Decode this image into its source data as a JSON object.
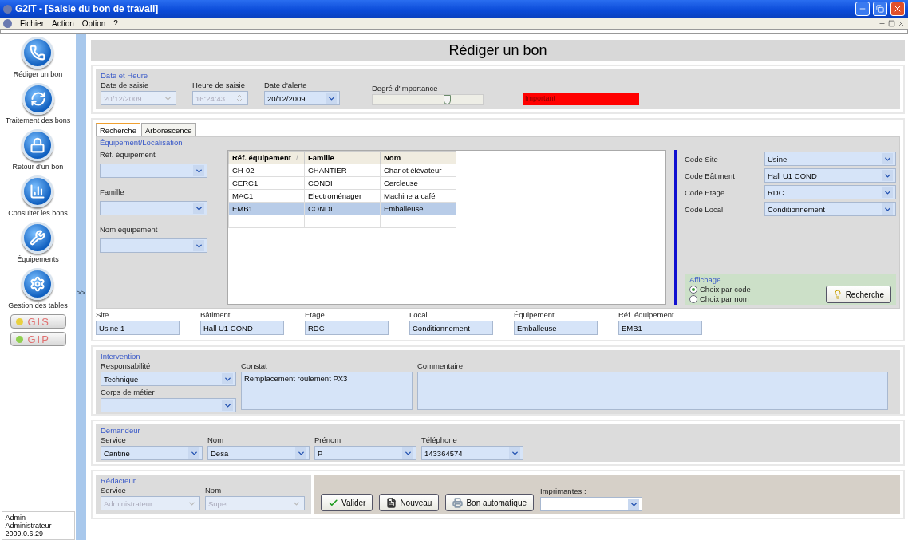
{
  "window": {
    "title": "G2IT - [Saisie du bon de travail]"
  },
  "menu": [
    "Fichier",
    "Action",
    "Option",
    "?"
  ],
  "sidebar": {
    "items": [
      {
        "label": "Rédiger un bon",
        "kind": "phone"
      },
      {
        "label": "Traitement des bons",
        "kind": "refresh"
      },
      {
        "label": "Retour d'un bon",
        "kind": "lock"
      },
      {
        "label": "Consulter les bons",
        "kind": "chart"
      },
      {
        "label": "Équipements",
        "kind": "tools"
      },
      {
        "label": "Gestion des tables",
        "kind": "gear"
      }
    ],
    "badges": [
      {
        "label": "GIS",
        "color": "#e8d040"
      },
      {
        "label": "GIP",
        "color": "#90d050"
      }
    ],
    "user": [
      "Admin",
      "Administrateur",
      "2009.0.6.29"
    ]
  },
  "splitter": ">>",
  "page_title": "Rédiger un bon",
  "date_heure": {
    "title": "Date et Heure",
    "fields": [
      {
        "label": "Date de saisie",
        "value": "20/12/2009",
        "kind": "date",
        "disabled": true
      },
      {
        "label": "Heure de saisie",
        "value": "16:24:43",
        "kind": "time",
        "disabled": true
      },
      {
        "label": "Date d'alerte",
        "value": "20/12/2009",
        "kind": "date",
        "disabled": false
      }
    ],
    "importance": {
      "label": "Degré d'importance",
      "level": 0.68,
      "reading": "Important",
      "color": "#ff0000"
    }
  },
  "tabs": [
    {
      "label": "Recherche",
      "selected": true
    },
    {
      "label": "Arborescence",
      "selected": false
    }
  ],
  "equipement": {
    "title": "Équipement/Localisation",
    "filters": [
      {
        "label": "Réf. équipement"
      },
      {
        "label": "Famille"
      },
      {
        "label": "Nom équipement"
      }
    ],
    "table": {
      "columns": [
        {
          "label": "Réf. équipement",
          "sort_mark": "/"
        },
        {
          "label": "Famille"
        },
        {
          "label": "Nom"
        }
      ],
      "rows": [
        {
          "cells": [
            "CH-02",
            "CHANTIER",
            "Chariot élévateur"
          ],
          "selected": false
        },
        {
          "cells": [
            "CERC1",
            "CONDI",
            "Cercleuse"
          ],
          "selected": false
        },
        {
          "cells": [
            "MAC1",
            "Electroménager",
            "Machine a café"
          ],
          "selected": false
        },
        {
          "cells": [
            "EMB1",
            "CONDI",
            "Emballeuse"
          ],
          "selected": true
        }
      ]
    },
    "codes": [
      {
        "label": "Code Site",
        "value": "Usine"
      },
      {
        "label": "Code Bâtiment",
        "value": "Hall U1 COND"
      },
      {
        "label": "Code Etage",
        "value": "RDC"
      },
      {
        "label": "Code Local",
        "value": "Conditionnement"
      }
    ],
    "affichage": {
      "title": "Affichage",
      "options": [
        {
          "label": "Choix par code",
          "selected": true
        },
        {
          "label": "Choix par nom",
          "selected": false
        }
      ],
      "button": "Recherche"
    }
  },
  "location": [
    {
      "label": "Site",
      "value": "Usine 1"
    },
    {
      "label": "Bâtiment",
      "value": "Hall U1 COND"
    },
    {
      "label": "Etage",
      "value": "RDC"
    },
    {
      "label": "Local",
      "value": "Conditionnement"
    },
    {
      "label": "Équipement",
      "value": "Emballeuse"
    },
    {
      "label": "Réf. équipement",
      "value": "EMB1"
    }
  ],
  "intervention": {
    "title": "Intervention",
    "responsabilite": {
      "label": "Responsabilité",
      "value": "Technique"
    },
    "corps": {
      "label": "Corps de métier"
    },
    "constat": {
      "label": "Constat",
      "value": "Remplacement roulement PX3"
    },
    "commentaire": {
      "label": "Commentaire"
    }
  },
  "demandeur": {
    "title": "Demandeur",
    "fields": [
      {
        "label": "Service",
        "value": "Cantine"
      },
      {
        "label": "Nom",
        "value": "Desa"
      },
      {
        "label": "Prénom",
        "value": "P"
      },
      {
        "label": "Téléphone",
        "value": "143364574"
      }
    ]
  },
  "redacteur": {
    "title": "Rédacteur",
    "fields": [
      {
        "label": "Service",
        "value": "Administrateur",
        "disabled": true
      },
      {
        "label": "Nom",
        "value": "Super",
        "disabled": true
      }
    ]
  },
  "actions": [
    {
      "label": "Valider",
      "kind": "check"
    },
    {
      "label": "Nouveau",
      "kind": "page"
    },
    {
      "label": "Bon automatique",
      "kind": "auto"
    }
  ],
  "imprimantes": {
    "label": "Imprimantes :"
  }
}
